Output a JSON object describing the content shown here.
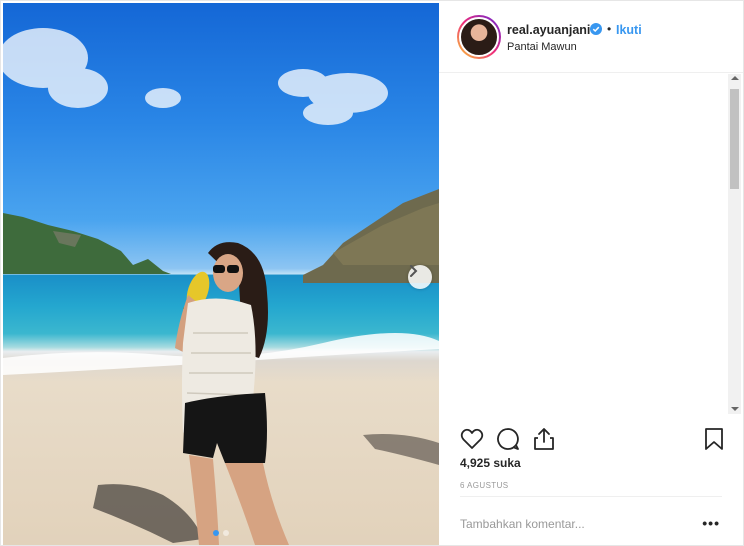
{
  "post": {
    "username": "real.ayuanjani",
    "verified": true,
    "separator": "•",
    "follow_label": "Ikuti",
    "location": "Pantai Mawun",
    "likes_text": "4,925 suka",
    "date_text": "6 AGUSTUS",
    "comment_placeholder": "Tambahkan komentar...",
    "more_label": "•••",
    "carousel": {
      "slide_count": 2,
      "active_index": 0
    }
  },
  "icons": {
    "verified": "verified-badge-icon",
    "next": "chevron-right-icon",
    "like": "heart-icon",
    "comment": "speech-bubble-icon",
    "share": "share-icon",
    "save": "bookmark-icon"
  },
  "colors": {
    "link": "#3897f0",
    "text": "#262626",
    "muted": "#999999"
  }
}
